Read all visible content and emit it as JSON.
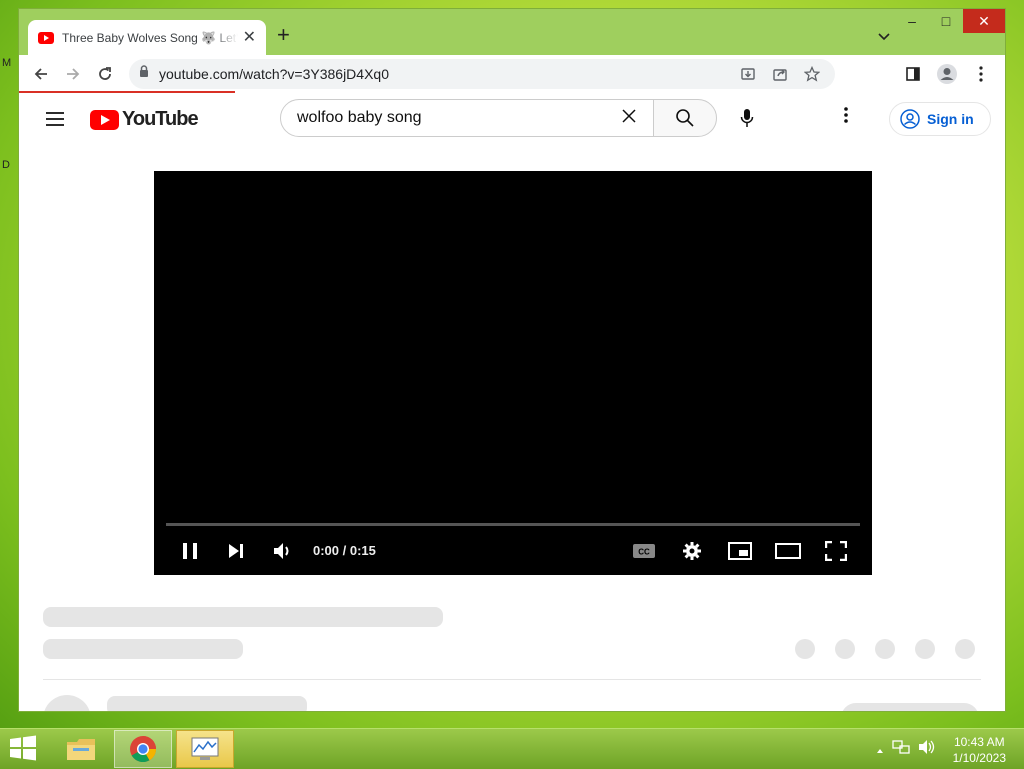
{
  "desktop": {
    "edge_labels": [
      "M",
      "D"
    ]
  },
  "browser": {
    "tab": {
      "title": "Three Baby Wolves Song 🐺 Let's Sing"
    },
    "window_controls": {
      "minimize": "–",
      "maximize": "□",
      "close": "✕"
    },
    "address": {
      "url": "youtube.com/watch?v=3Y386jD4Xq0"
    }
  },
  "youtube": {
    "logo_text": "YouTube",
    "search": {
      "query": "wolfoo baby song"
    },
    "signin_label": "Sign in",
    "player": {
      "time": "0:00 / 0:15",
      "progress": 0.0
    }
  },
  "taskbar": {
    "clock_time": "10:43 AM",
    "clock_date": "1/10/2023"
  },
  "colors": {
    "youtube_red": "#ff0000",
    "link_blue": "#065fd4",
    "loading_bar": "#d93025",
    "close_red": "#c42b1c"
  }
}
